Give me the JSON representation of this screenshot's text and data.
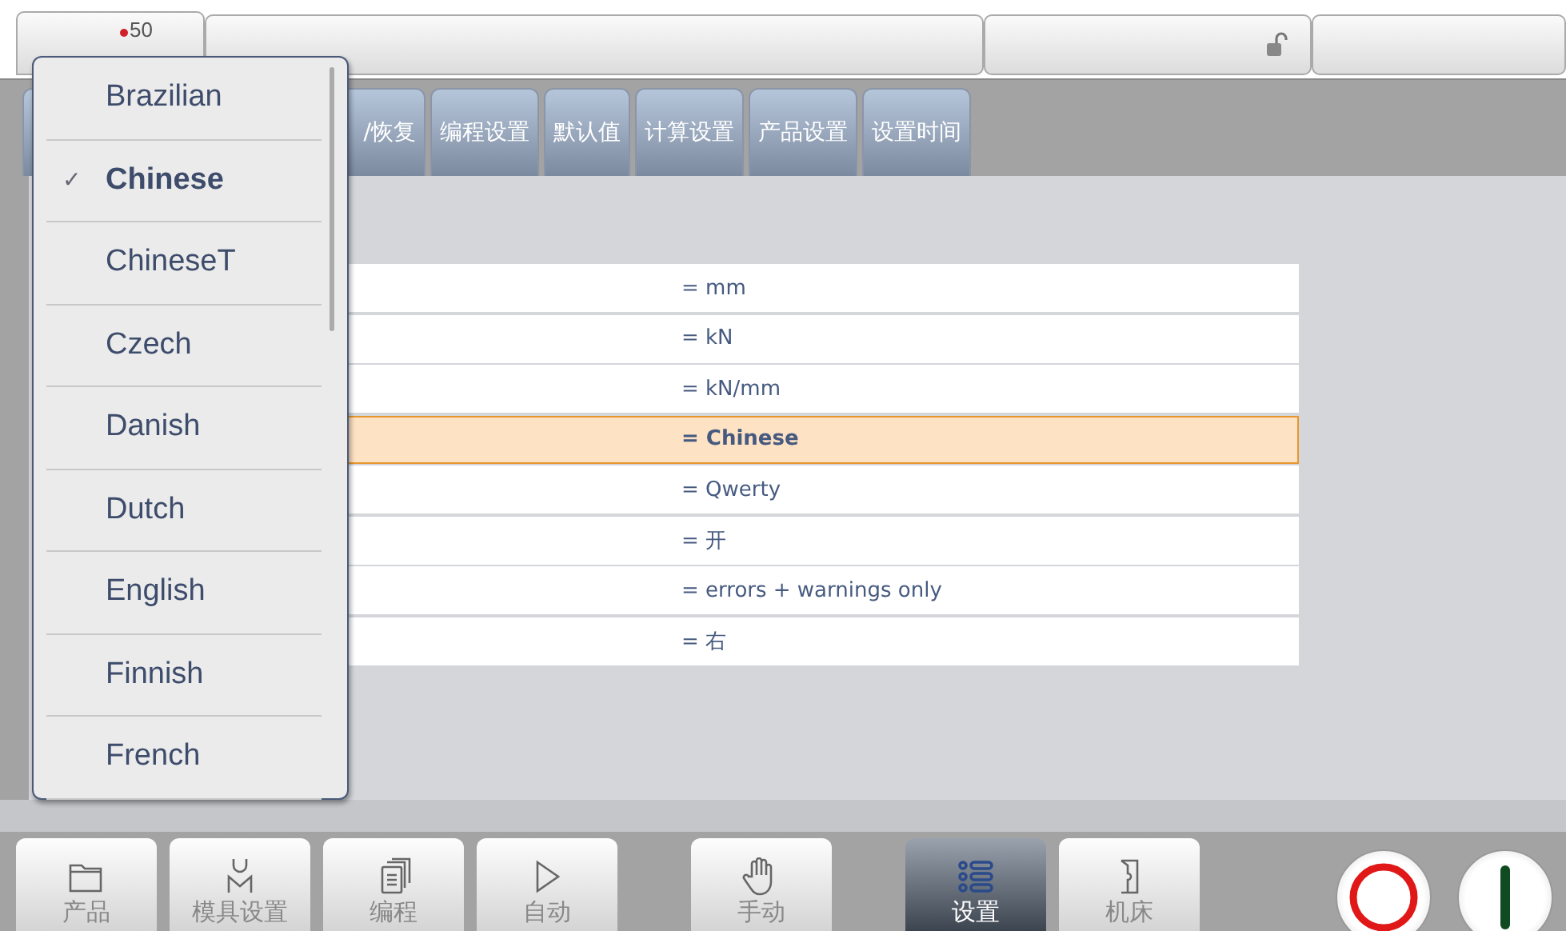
{
  "logo": {
    "model": "50"
  },
  "top_fields": [
    {
      "kind": "blank"
    },
    {
      "kind": "lock"
    },
    {
      "kind": "blank"
    }
  ],
  "tabs": [
    {
      "label": "/恢复",
      "selected": false
    },
    {
      "label": "编程设置",
      "selected": false
    },
    {
      "label": "默认值",
      "selected": false
    },
    {
      "label": "计算设置",
      "selected": false
    },
    {
      "label": "产品设置",
      "selected": false
    },
    {
      "label": "设置时间",
      "selected": false
    }
  ],
  "settings": [
    {
      "value": "= mm",
      "selected": false
    },
    {
      "value": "= kN",
      "selected": false
    },
    {
      "value": "= kN/mm",
      "selected": false
    },
    {
      "value": "= Chinese",
      "selected": true
    },
    {
      "value": "= Qwerty",
      "selected": false
    },
    {
      "value": "= 开",
      "selected": false
    },
    {
      "value": "= errors + warnings only",
      "selected": false
    },
    {
      "value": "= 右",
      "selected": false
    }
  ],
  "language_menu": [
    {
      "label": "Brazilian",
      "selected": false
    },
    {
      "label": "Chinese",
      "selected": true
    },
    {
      "label": "ChineseT",
      "selected": false
    },
    {
      "label": "Czech",
      "selected": false
    },
    {
      "label": "Danish",
      "selected": false
    },
    {
      "label": "Dutch",
      "selected": false
    },
    {
      "label": "English",
      "selected": false
    },
    {
      "label": "Finnish",
      "selected": false
    },
    {
      "label": "French",
      "selected": false
    }
  ],
  "check_mark": "✓",
  "nav": [
    {
      "label": "产品",
      "selected": false
    },
    {
      "label": "模具设置",
      "selected": false
    },
    {
      "label": "编程",
      "selected": false
    },
    {
      "label": "自动",
      "selected": false
    },
    {
      "label": "手动",
      "selected": false
    },
    {
      "label": "设置",
      "selected": true
    },
    {
      "label": "机床",
      "selected": false
    }
  ],
  "controls": [
    {
      "kind": "stop"
    },
    {
      "kind": "start"
    }
  ]
}
